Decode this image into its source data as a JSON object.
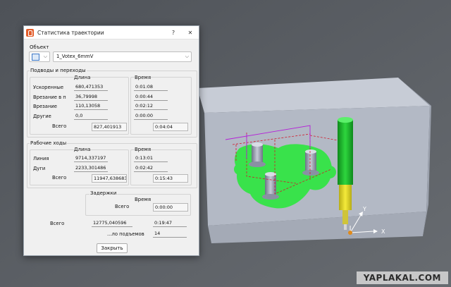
{
  "window": {
    "title": "Статистика траектории",
    "help": "?",
    "close": "✕"
  },
  "object": {
    "group_label": "Объект",
    "selected": "1_Votex_6mmV",
    "icon": "toolpath-icon"
  },
  "approach": {
    "group_label": "Подводы и переходы",
    "length_header": "Длина",
    "time_header": "Время",
    "rows": [
      {
        "label": "Ускоренные",
        "length": "680,471353",
        "time": "0:01:08"
      },
      {
        "label": "Врезание в п",
        "length": "36,79998",
        "time": "0:00:44"
      },
      {
        "label": "Врезание",
        "length": "110,13058",
        "time": "0:02:12"
      },
      {
        "label": "Другие",
        "length": "0,0",
        "time": "0:00:00"
      }
    ],
    "total_label": "Всего",
    "total_length": "827,401913",
    "total_time": "0:04:04"
  },
  "working": {
    "group_label": "Рабочие ходы",
    "length_header": "Длина",
    "time_header": "Время",
    "rows": [
      {
        "label": "Линия",
        "length": "9714,337197",
        "time": "0:13:01"
      },
      {
        "label": "Дуги",
        "length": "2233,301486",
        "time": "0:02:42"
      }
    ],
    "total_label": "Всего",
    "total_length": "11947,638683",
    "total_time": "0:15:43"
  },
  "delays": {
    "group_label": "Задержки",
    "time_header": "Время",
    "total_label": "Всего",
    "total_time": "0:00:00"
  },
  "summary": {
    "total_label": "Всего",
    "total_length": "12775,040596",
    "total_time": "0:19:47",
    "lifts_label": "...ло подъемов",
    "lifts_value": "14"
  },
  "close_button": "Закрыть",
  "view": {
    "axis_x": "X",
    "axis_y": "Y",
    "colors": {
      "stock": "#b9bfca",
      "part": "#39e24b",
      "tool_upper": "#1bbf2a",
      "tool_lower": "#e9e02a",
      "rapid": "#d11a2a"
    }
  },
  "watermark": "YAPLAKAL.COM"
}
